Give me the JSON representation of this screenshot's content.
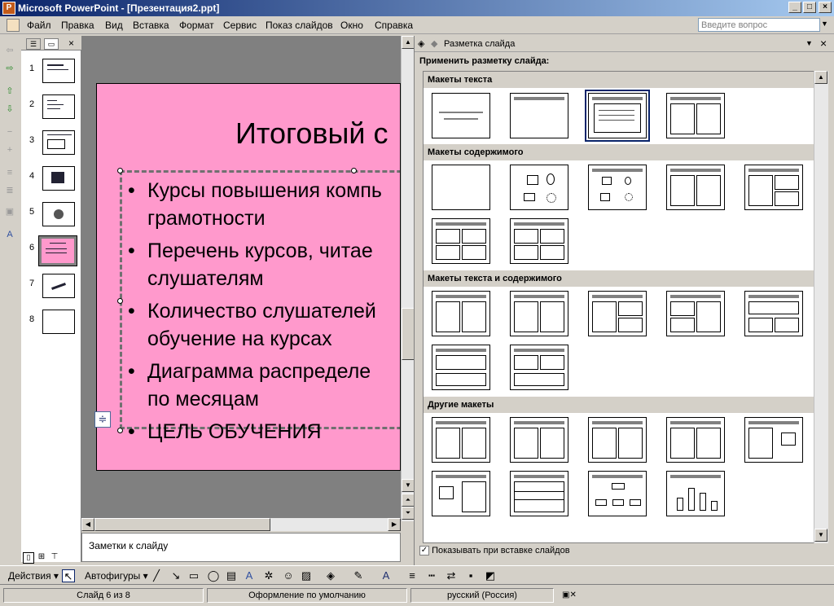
{
  "window": {
    "title": "Microsoft PowerPoint - [Презентация2.ppt]",
    "min": "_",
    "max": "□",
    "close": "×"
  },
  "menu": [
    "Файл",
    "Правка",
    "Вид",
    "Вставка",
    "Формат",
    "Сервис",
    "Показ слайдов",
    "Окно",
    "Справка"
  ],
  "help": {
    "placeholder": "Введите вопрос"
  },
  "thumbs": [
    "1",
    "2",
    "3",
    "4",
    "5",
    "6",
    "7",
    "8"
  ],
  "thumb_selected": 6,
  "slide": {
    "title": "Итоговый с",
    "bullets": [
      [
        "Курсы повышения компь",
        "грамотности"
      ],
      [
        "Перечень курсов, читае",
        "слушателям"
      ],
      [
        "Количество слушателей",
        "обучение на курсах"
      ],
      [
        "Диаграмма распределе",
        "по месяцам"
      ],
      [
        "ЦЕЛЬ ОБУЧЕНИЯ"
      ]
    ]
  },
  "notes_placeholder": "Заметки к слайду",
  "taskpane": {
    "title": "Разметка слайда",
    "apply_label": "Применить разметку слайда:",
    "categories": [
      "Макеты текста",
      "Макеты содержимого",
      "Макеты текста и содержимого",
      "Другие макеты"
    ],
    "show_on_insert": "Показывать при вставке слайдов"
  },
  "drawbar": {
    "actions": "Действия",
    "autoshapes": "Автофигуры"
  },
  "status": {
    "slide": "Слайд 6 из 8",
    "design": "Оформление по умолчанию",
    "lang": "русский (Россия)"
  },
  "colors": {
    "slide_bg": "#ff99cc",
    "titlebar": "#0a246a"
  }
}
